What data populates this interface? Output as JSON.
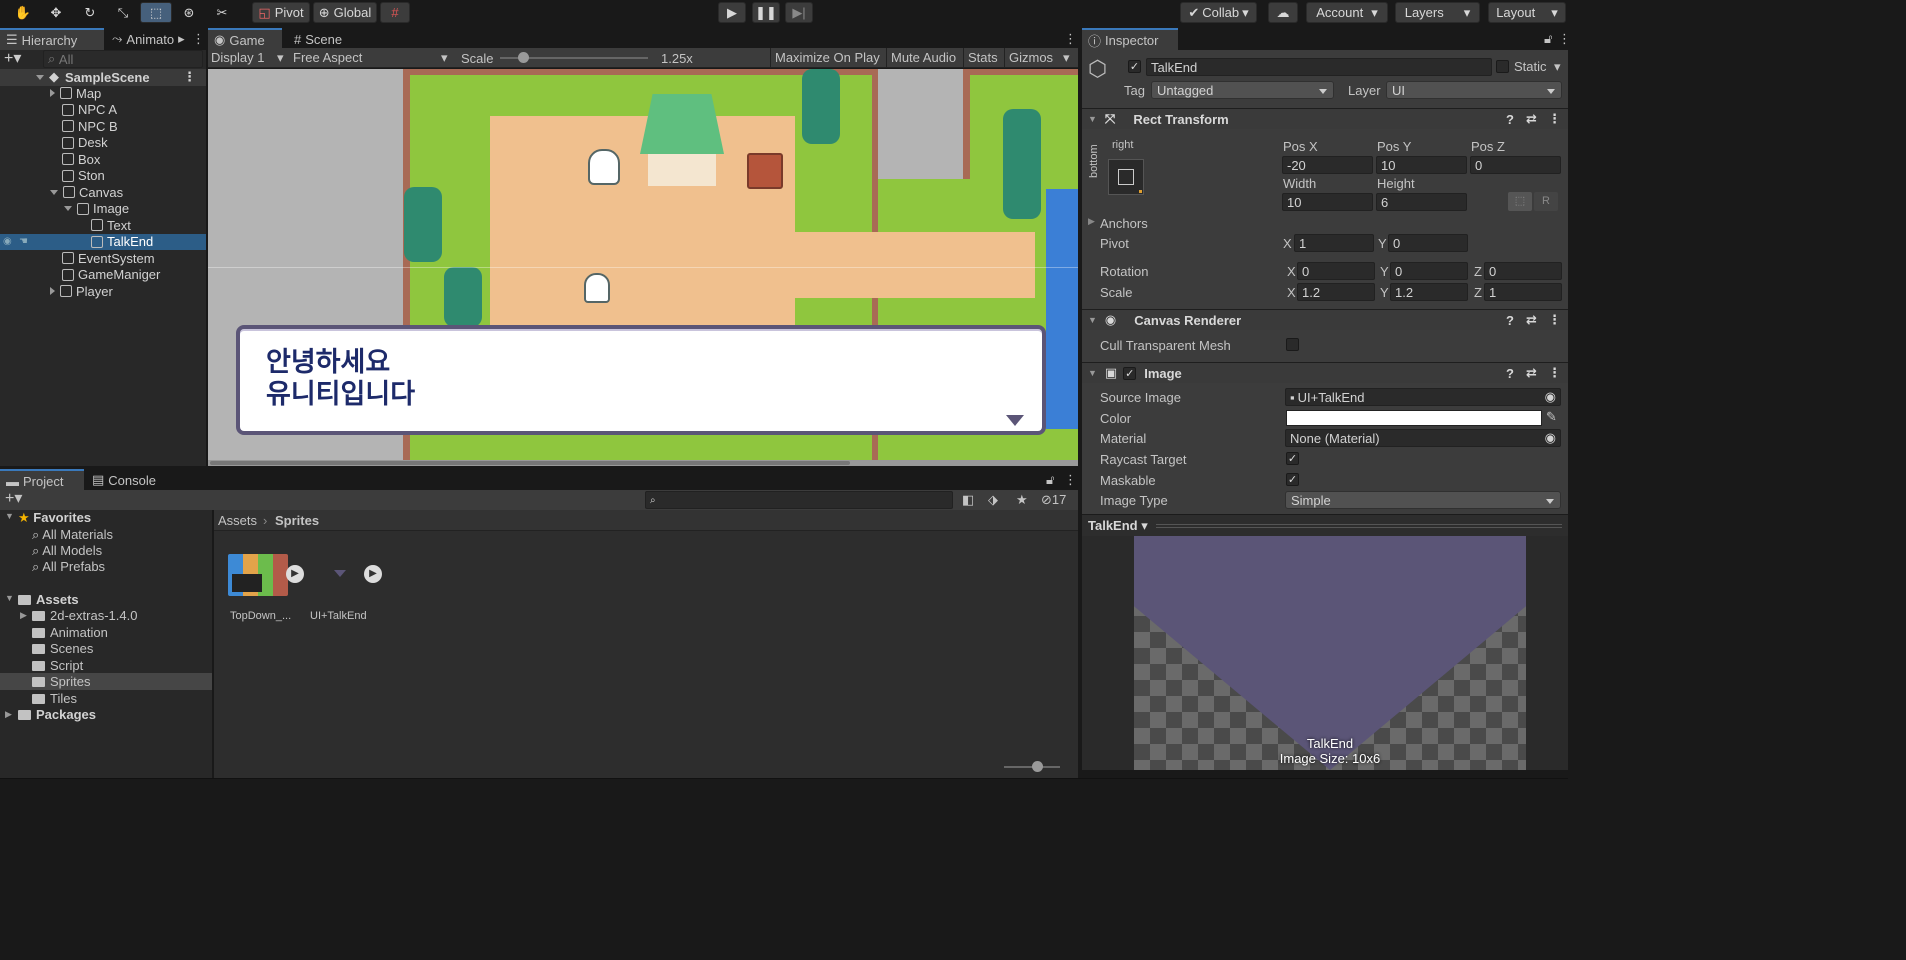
{
  "toolbar": {
    "pivot": "Pivot",
    "global": "Global",
    "collab": "Collab",
    "account": "Account",
    "layers": "Layers",
    "layout": "Layout"
  },
  "hierarchy": {
    "tab": "Hierarchy",
    "tab2": "Animato",
    "search_placeholder": "All",
    "scene": "SampleScene",
    "items": [
      "Map",
      "NPC A",
      "NPC B",
      "Desk",
      "Box",
      "Ston",
      "Canvas",
      "Image",
      "Text",
      "TalkEnd",
      "EventSystem",
      "GameManiger",
      "Player"
    ]
  },
  "game": {
    "tab_game": "Game",
    "tab_scene": "Scene",
    "display": "Display 1",
    "aspect": "Free Aspect",
    "scale_label": "Scale",
    "scale_value": "1.25x",
    "maximize": "Maximize On Play",
    "mute": "Mute Audio",
    "stats": "Stats",
    "gizmos": "Gizmos",
    "dialog_line1": "안녕하세요",
    "dialog_line2": "유니티입니다"
  },
  "inspector": {
    "tab": "Inspector",
    "object_name": "TalkEnd",
    "static_label": "Static",
    "tag_label": "Tag",
    "tag_value": "Untagged",
    "layer_label": "Layer",
    "layer_value": "UI",
    "rect": {
      "title": "Rect Transform",
      "anchor_h": "right",
      "anchor_v": "bottom",
      "posx_label": "Pos X",
      "posy_label": "Pos Y",
      "posz_label": "Pos Z",
      "posx": "-20",
      "posy": "10",
      "posz": "0",
      "width_label": "Width",
      "height_label": "Height",
      "width": "10",
      "height": "6",
      "r_btn": "R",
      "anchors": "Anchors",
      "pivot": "Pivot",
      "pivot_x": "1",
      "pivot_y": "0",
      "rotation": "Rotation",
      "rot_x": "0",
      "rot_y": "0",
      "rot_z": "0",
      "scale": "Scale",
      "scale_x": "1.2",
      "scale_y": "1.2",
      "scale_z": "1",
      "x": "X",
      "y": "Y",
      "z": "Z"
    },
    "canvas_renderer": {
      "title": "Canvas Renderer",
      "cull": "Cull Transparent Mesh"
    },
    "image": {
      "title": "Image",
      "source_label": "Source Image",
      "source_value": "UI+TalkEnd",
      "color_label": "Color",
      "material_label": "Material",
      "material_value": "None (Material)",
      "raycast_label": "Raycast Target",
      "maskable_label": "Maskable",
      "type_label": "Image Type",
      "type_value": "Simple"
    },
    "preview": {
      "title": "TalkEnd",
      "name": "TalkEnd",
      "size": "Image Size: 10x6"
    }
  },
  "project": {
    "tab_project": "Project",
    "tab_console": "Console",
    "hidden_count": "17",
    "favorites": "Favorites",
    "fav_items": [
      "All Materials",
      "All Models",
      "All Prefabs"
    ],
    "assets": "Assets",
    "asset_folders": [
      "2d-extras-1.4.0",
      "Animation",
      "Scenes",
      "Script",
      "Sprites",
      "Tiles"
    ],
    "packages": "Packages",
    "breadcrumb_root": "Assets",
    "breadcrumb_leaf": "Sprites",
    "asset1": "TopDown_...",
    "asset2": "UI+TalkEnd"
  }
}
